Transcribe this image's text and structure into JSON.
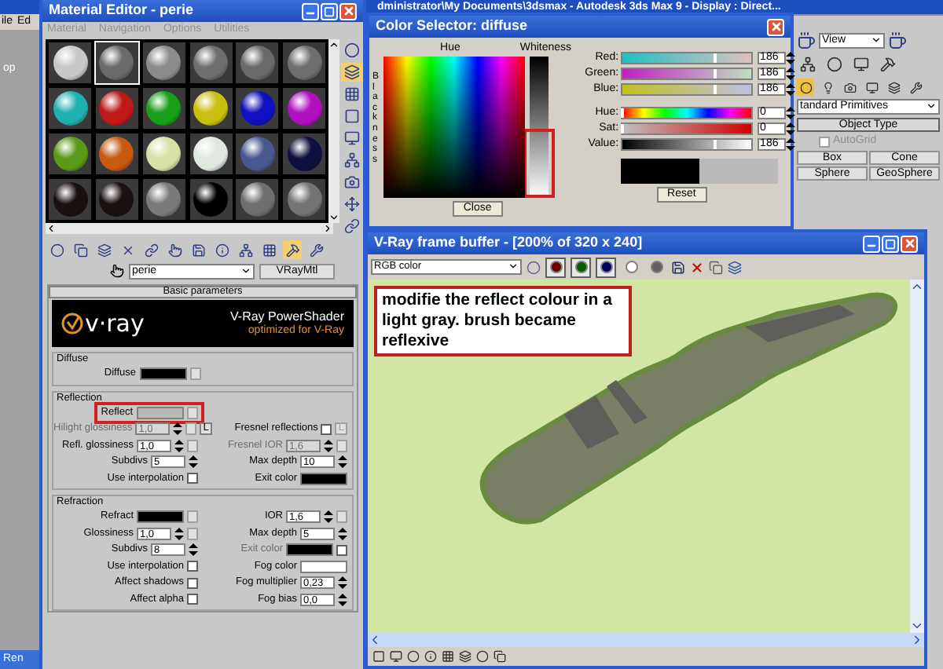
{
  "app_title": "dministrator\\My Documents\\3dsmax - Autodesk 3ds Max 9 - Display : Direct...",
  "viewport": {
    "menu": [
      "ile",
      "Ed"
    ],
    "label": "op",
    "taskbar_button": "Ren"
  },
  "material_editor": {
    "title": "Material Editor - perie",
    "menu": [
      {
        "label": "Material",
        "disabled": true
      },
      {
        "label": "Navigation",
        "disabled": true
      },
      {
        "label": "Options",
        "disabled": true
      },
      {
        "label": "Utilities",
        "disabled": true
      }
    ],
    "slots": [
      {
        "color": "#c8c8c8",
        "selected": false
      },
      {
        "color": "#6a6a6a",
        "selected": true
      },
      {
        "color": "#8c8c8c",
        "selected": false
      },
      {
        "color": "#6e6e6e",
        "selected": false
      },
      {
        "color": "#6a6a6a",
        "selected": false
      },
      {
        "color": "#6e6e6e",
        "selected": false
      },
      {
        "color": "#20b0b0",
        "selected": false
      },
      {
        "color": "#c01818",
        "selected": false
      },
      {
        "color": "#18a018",
        "selected": false
      },
      {
        "color": "#c8c010",
        "selected": false
      },
      {
        "color": "#1010c0",
        "selected": false
      },
      {
        "color": "#b010c0",
        "selected": false
      },
      {
        "color": "#5a9a18",
        "selected": false
      },
      {
        "color": "#c85a10",
        "selected": false
      },
      {
        "color": "#d8e0a8",
        "selected": false
      },
      {
        "color": "#e0e8e0",
        "selected": false
      },
      {
        "color": "#4a5890",
        "selected": false
      },
      {
        "color": "#101040",
        "selected": false
      },
      {
        "color": "#1a1010",
        "selected": false
      },
      {
        "color": "#1a1010",
        "selected": false
      },
      {
        "color": "#7a7a7a",
        "selected": false
      },
      {
        "color": "#000000",
        "selected": false
      },
      {
        "color": "#6e6e6e",
        "selected": false
      },
      {
        "color": "#747474",
        "selected": false
      }
    ],
    "material_name": "perie",
    "material_type": "VRayMtl",
    "rollout": "Basic parameters",
    "banner": {
      "logo": "v·ray",
      "title": "V-Ray PowerShader",
      "subtitle": "optimized for V-Ray"
    },
    "groups": [
      {
        "title": "Diffuse",
        "rows": [
          [
            {
              "kind": "color",
              "label": "Diffuse",
              "color": "#000000",
              "map": true,
              "annotated": false
            },
            null
          ]
        ]
      },
      {
        "title": "Reflection",
        "rows": [
          [
            {
              "kind": "color",
              "label": "Reflect",
              "color": "#b8b8b8",
              "map": true,
              "annotated": true
            },
            null
          ],
          [
            {
              "kind": "spinner",
              "label": "Hilight glossiness",
              "value": "1,0",
              "disabled": true,
              "map": true,
              "lock": "L"
            },
            {
              "kind": "checkbox",
              "label": "Fresnel reflections",
              "checked": false,
              "lock": "L"
            }
          ],
          [
            {
              "kind": "spinner",
              "label": "Refl. glossiness",
              "value": "1,0",
              "disabled": false,
              "map": true
            },
            {
              "kind": "spinner",
              "label": "Fresnel IOR",
              "value": "1,6",
              "disabled": true,
              "map": true
            }
          ],
          [
            {
              "kind": "spinner",
              "label": "Subdivs",
              "value": "5",
              "disabled": false
            },
            {
              "kind": "spinner",
              "label": "Max depth",
              "value": "10",
              "disabled": false
            }
          ],
          [
            {
              "kind": "checkbox",
              "label": "Use interpolation",
              "checked": false
            },
            {
              "kind": "color",
              "label": "Exit color",
              "color": "#000000",
              "annotated": false
            }
          ]
        ]
      },
      {
        "title": "Refraction",
        "rows": [
          [
            {
              "kind": "color",
              "label": "Refract",
              "color": "#000000",
              "map": true,
              "annotated": false
            },
            {
              "kind": "spinner",
              "label": "IOR",
              "value": "1,6",
              "disabled": false,
              "map": true
            }
          ],
          [
            {
              "kind": "spinner",
              "label": "Glossiness",
              "value": "1,0",
              "disabled": false,
              "map": true
            },
            {
              "kind": "spinner",
              "label": "Max depth",
              "value": "5",
              "disabled": false
            }
          ],
          [
            {
              "kind": "spinner",
              "label": "Subdivs",
              "value": "8",
              "disabled": false
            },
            {
              "kind": "color",
              "label": "Exit color",
              "color": "#000000",
              "disabled": true,
              "checked": false,
              "annotated": false
            }
          ],
          [
            {
              "kind": "checkbox",
              "label": "Use interpolation",
              "checked": false
            },
            {
              "kind": "color",
              "label": "Fog color",
              "color": "#ffffff",
              "annotated": false
            }
          ],
          [
            {
              "kind": "checkbox",
              "label": "Affect shadows",
              "checked": false
            },
            {
              "kind": "spinner",
              "label": "Fog multiplier",
              "value": "0,23",
              "disabled": false
            }
          ],
          [
            {
              "kind": "checkbox",
              "label": "Affect alpha",
              "checked": false
            },
            {
              "kind": "spinner",
              "label": "Fog bias",
              "value": "0,0",
              "disabled": false
            }
          ]
        ]
      }
    ]
  },
  "color_selector": {
    "title": "Color Selector: diffuse",
    "hue_label": "Hue",
    "whiteness_label": "Whiteness",
    "blackness_label": "Blackness",
    "whiteness_annotated": true,
    "sliders": [
      {
        "kind": "red",
        "label": "Red:",
        "level": 0.73,
        "reading": "186"
      },
      {
        "kind": "green",
        "label": "Green:",
        "level": 0.73,
        "reading": "186"
      },
      {
        "kind": "blue",
        "label": "Blue:",
        "level": 0.73,
        "reading": "186"
      },
      {
        "kind": "hue",
        "label": "Hue:",
        "level": 0,
        "reading": "0"
      },
      {
        "kind": "sat",
        "label": "Sat:",
        "level": 0,
        "reading": "0"
      },
      {
        "kind": "value",
        "label": "Value:",
        "level": 0.73,
        "reading": "186"
      }
    ],
    "buttons": [
      "Close",
      "Reset"
    ]
  },
  "command_panel": {
    "view": "View",
    "creation_list": "tandard Primitives",
    "rollout": "Object Type",
    "autogrid": {
      "label": "AutoGrid",
      "checked": false,
      "disabled": true
    },
    "buttons": [
      "Box",
      "Cone",
      "Sphere",
      "GeoSphere"
    ]
  },
  "frame_buffer": {
    "title": "V-Ray frame buffer - [200% of 320 x 240]",
    "channel": "RGB color",
    "channel_buttons": [
      {
        "kind": "red",
        "selected": true
      },
      {
        "kind": "green",
        "selected": true
      },
      {
        "kind": "blue",
        "selected": true
      },
      {
        "kind": "alpha",
        "selected": false
      },
      {
        "kind": "mono",
        "selected": false
      }
    ]
  },
  "annotation": "modifie the reflect colour in a light gray. brush became reflexive"
}
